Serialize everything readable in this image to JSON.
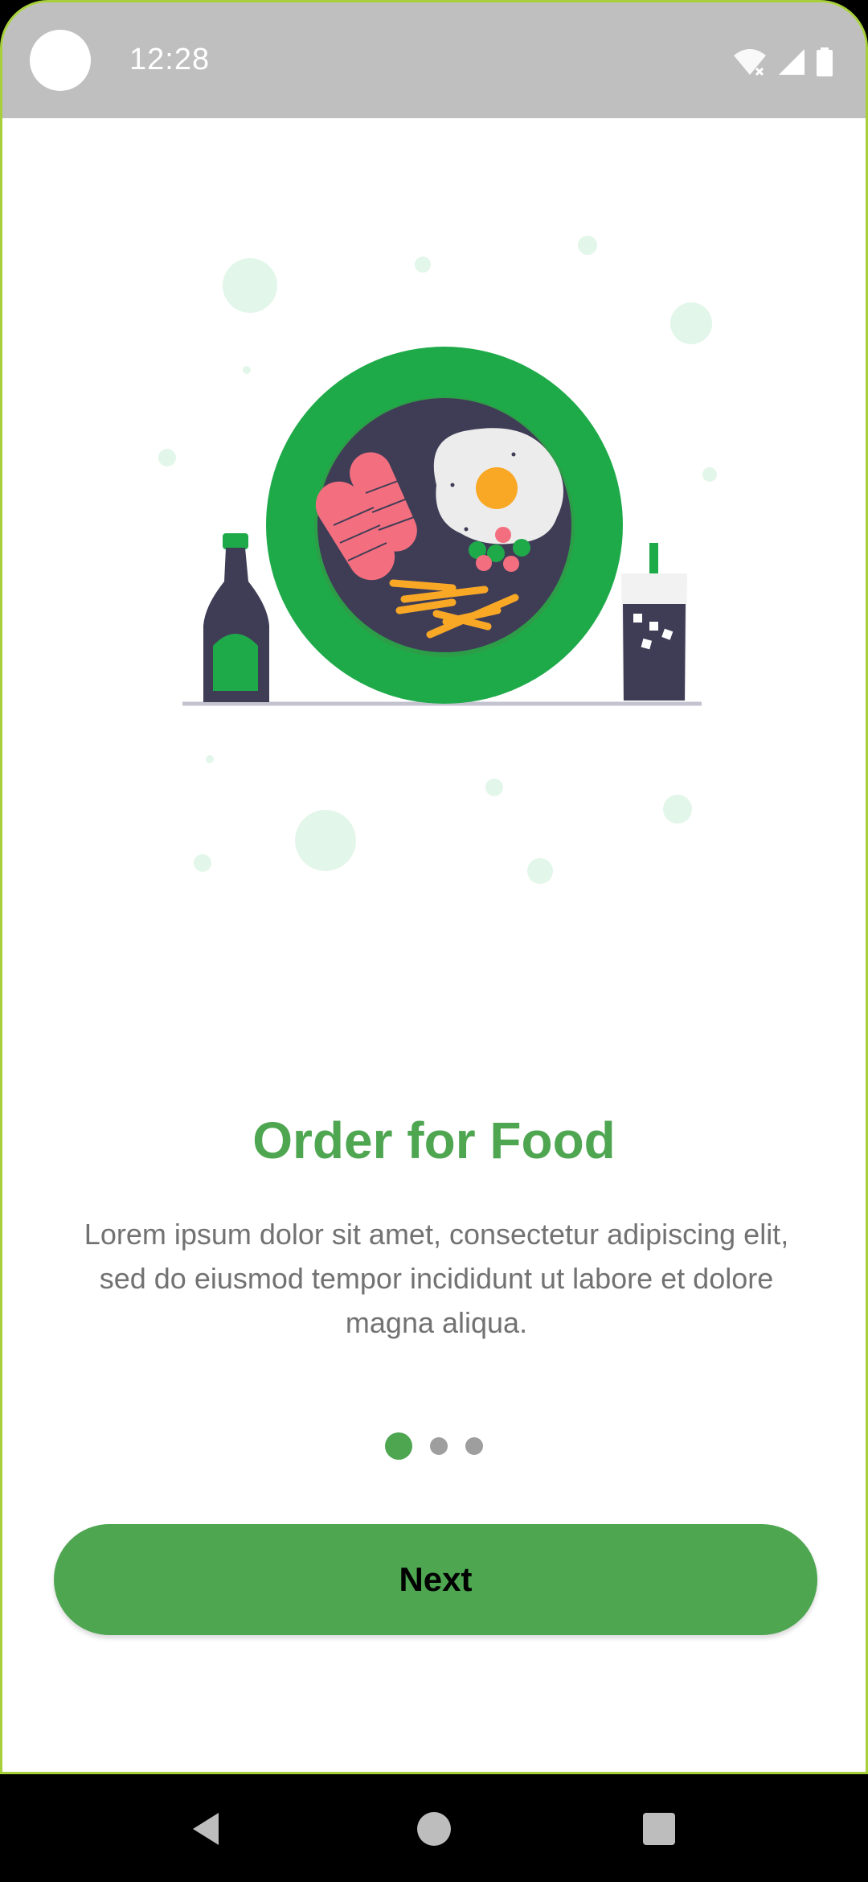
{
  "status_bar": {
    "time": "12:28",
    "icons": [
      "wifi-off-icon",
      "signal-icon",
      "battery-icon"
    ]
  },
  "illustration": {
    "name": "food-plate-illustration",
    "colors": {
      "plate": "#1faa4a",
      "inner": "#3f3d56",
      "sausage": "#f36f7f",
      "egg_white": "#ececec",
      "yolk": "#f9a826",
      "fries": "#f9a826",
      "bubble": "#e3f6ea"
    }
  },
  "onboarding": {
    "title": "Order for Food",
    "description": "Lorem ipsum dolor sit amet, consectetur adipiscing elit, sed do eiusmod tempor incididunt ut labore et dolore magna aliqua.",
    "page_indicator": {
      "current": 1,
      "total": 3
    },
    "next_label": "Next"
  },
  "nav_bar": {
    "buttons": [
      "back-icon",
      "home-icon",
      "recents-icon"
    ]
  },
  "colors": {
    "accent": "#4ea651",
    "status_bar": "#bfbfbf",
    "text_secondary": "#727272",
    "dot_inactive": "#9e9e9e"
  }
}
